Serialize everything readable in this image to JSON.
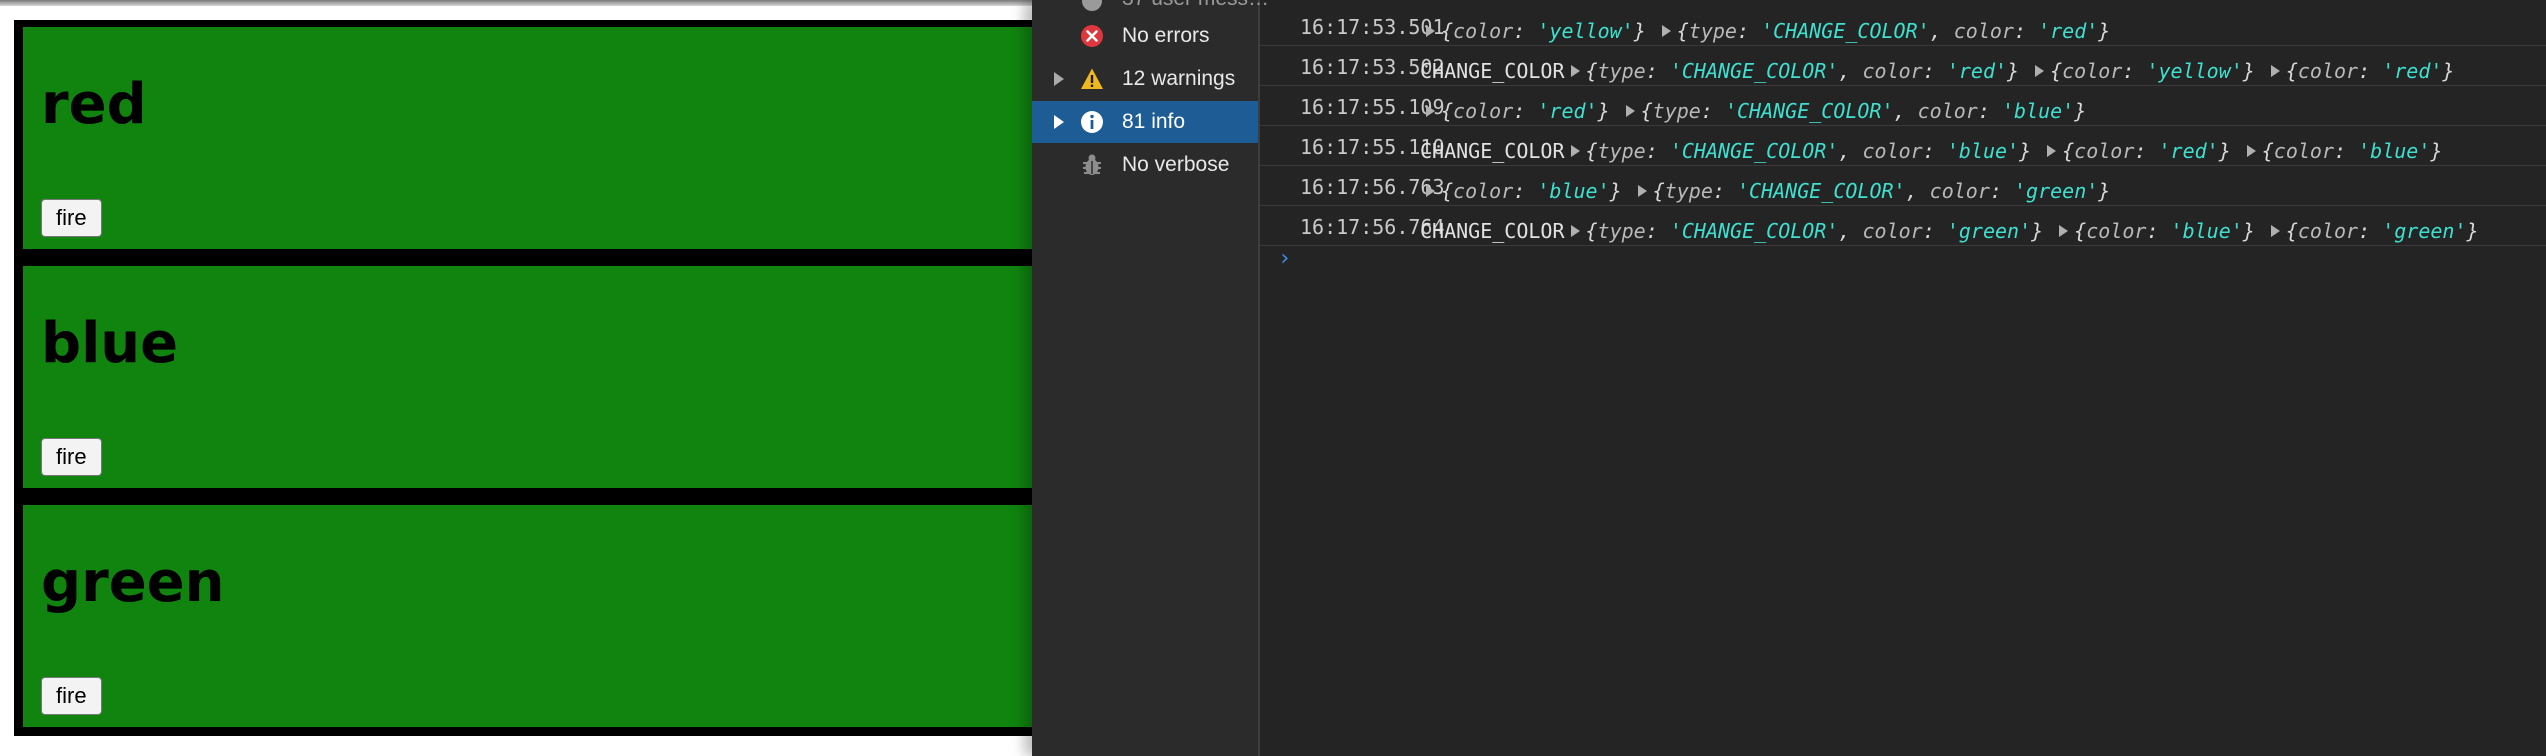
{
  "page": {
    "cards": [
      {
        "heading": "red",
        "button_label": "fire"
      },
      {
        "heading": "blue",
        "button_label": "fire"
      },
      {
        "heading": "green",
        "button_label": "fire"
      }
    ]
  },
  "devtools": {
    "sidebar": {
      "partial_top_label": "37 user mess…",
      "items": [
        {
          "label": "No errors",
          "icon": "error-icon"
        },
        {
          "label": "12 warnings",
          "icon": "warning-icon"
        },
        {
          "label": "81 info",
          "icon": "info-icon",
          "selected": true
        },
        {
          "label": "No verbose",
          "icon": "bug-icon"
        }
      ]
    },
    "console": {
      "messages": [
        {
          "time": "16:17:53.501",
          "text": "",
          "objects": [
            [
              {
                "k": "color",
                "v": "yellow"
              }
            ],
            [
              {
                "k": "type",
                "v": "CHANGE_COLOR"
              },
              {
                "k": "color",
                "v": "red"
              }
            ]
          ]
        },
        {
          "time": "16:17:53.502",
          "text": "CHANGE_COLOR",
          "objects": [
            [
              {
                "k": "type",
                "v": "CHANGE_COLOR"
              },
              {
                "k": "color",
                "v": "red"
              }
            ],
            [
              {
                "k": "color",
                "v": "yellow"
              }
            ],
            [
              {
                "k": "color",
                "v": "red"
              }
            ]
          ]
        },
        {
          "time": "16:17:55.109",
          "text": "",
          "objects": [
            [
              {
                "k": "color",
                "v": "red"
              }
            ],
            [
              {
                "k": "type",
                "v": "CHANGE_COLOR"
              },
              {
                "k": "color",
                "v": "blue"
              }
            ]
          ]
        },
        {
          "time": "16:17:55.110",
          "text": "CHANGE_COLOR",
          "objects": [
            [
              {
                "k": "type",
                "v": "CHANGE_COLOR"
              },
              {
                "k": "color",
                "v": "blue"
              }
            ],
            [
              {
                "k": "color",
                "v": "red"
              }
            ],
            [
              {
                "k": "color",
                "v": "blue"
              }
            ]
          ]
        },
        {
          "time": "16:17:56.763",
          "text": "",
          "objects": [
            [
              {
                "k": "color",
                "v": "blue"
              }
            ],
            [
              {
                "k": "type",
                "v": "CHANGE_COLOR"
              },
              {
                "k": "color",
                "v": "green"
              }
            ]
          ]
        },
        {
          "time": "16:17:56.764",
          "text": "CHANGE_COLOR",
          "objects": [
            [
              {
                "k": "type",
                "v": "CHANGE_COLOR"
              },
              {
                "k": "color",
                "v": "green"
              }
            ],
            [
              {
                "k": "color",
                "v": "blue"
              }
            ],
            [
              {
                "k": "color",
                "v": "green"
              }
            ]
          ]
        }
      ],
      "prompt_symbol": "›"
    }
  },
  "colors": {
    "card_background": "#10840f",
    "devtools_background": "#242424",
    "selected_item": "#1d5c94",
    "string_value": "#3ee0d0",
    "prompt": "#3b8ee8"
  }
}
